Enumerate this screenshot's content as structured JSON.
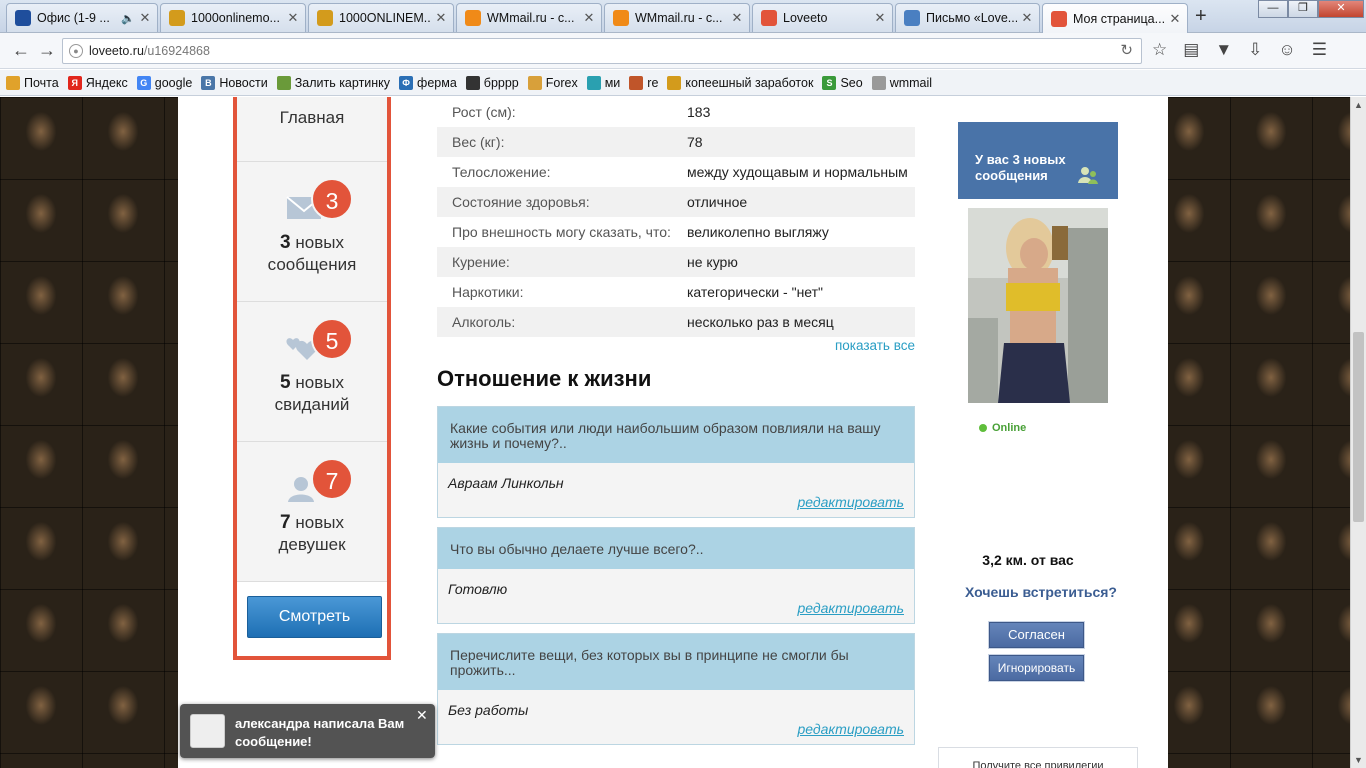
{
  "browser": {
    "tabs": [
      {
        "title": "Офис (1-9 ...",
        "icon": "office-icon",
        "color": "#1f4e9c",
        "audio": true
      },
      {
        "title": "1000onlinemo...",
        "icon": "coin-icon",
        "color": "#d39b1c"
      },
      {
        "title": "1000ONLINEM...",
        "icon": "coin-icon",
        "color": "#d39b1c"
      },
      {
        "title": "WMmail.ru - с...",
        "icon": "wmmail-icon",
        "color": "#f08a18"
      },
      {
        "title": "WMmail.ru - с...",
        "icon": "wmmail-icon",
        "color": "#f08a18"
      },
      {
        "title": "Loveeto",
        "icon": "loveeto-icon",
        "color": "#e2543a"
      },
      {
        "title": "Письмо «Love...",
        "icon": "mail-icon",
        "color": "#4a7fc1"
      },
      {
        "title": "Моя страница...",
        "icon": "loveeto-icon",
        "color": "#e2543a",
        "active": true
      }
    ],
    "url_host": "loveeto.ru",
    "url_path": "/u16924868",
    "bookmarks": [
      {
        "label": "Почта",
        "icon": "mail-folder-icon",
        "color": "#e0a22b"
      },
      {
        "label": "Яндекс",
        "icon": "yandex-icon",
        "color": "#e1261c",
        "glyph": "Я"
      },
      {
        "label": "google",
        "icon": "google-icon",
        "color": "#4285f4",
        "glyph": "G"
      },
      {
        "label": "Новости",
        "icon": "vk-icon",
        "color": "#4a76a8",
        "glyph": "В"
      },
      {
        "label": "Залить картинку",
        "icon": "upload-icon",
        "color": "#6a9a3a"
      },
      {
        "label": "ферма",
        "icon": "farm-icon",
        "color": "#2b6fb5",
        "glyph": "Ф"
      },
      {
        "label": "брррр",
        "icon": "clapper-icon",
        "color": "#333333"
      },
      {
        "label": "Forex",
        "icon": "forex-icon",
        "color": "#d8a03a"
      },
      {
        "label": "ми",
        "icon": "mi-icon",
        "color": "#2aa0b0"
      },
      {
        "label": "re",
        "icon": "re-icon",
        "color": "#c0552a"
      },
      {
        "label": "копеешный заработок",
        "icon": "coin-icon",
        "color": "#d39b1c"
      },
      {
        "label": "Seo",
        "icon": "seo-icon",
        "color": "#3a9a3a",
        "glyph": "S"
      },
      {
        "label": "wmmail",
        "icon": "wmmail-icon",
        "color": "#999999"
      }
    ]
  },
  "sidebar": {
    "main_label": "Главная",
    "sections": [
      {
        "count": "3",
        "word1": "новых",
        "word2": "сообщения",
        "icon": "envelope-icon"
      },
      {
        "count": "5",
        "word1": "новых",
        "word2": "свиданий",
        "icon": "hearts-icon"
      },
      {
        "count": "7",
        "word1": "новых",
        "word2": "девушек",
        "icon": "user-icon"
      }
    ],
    "button_label": "Смотреть"
  },
  "profile": {
    "rows": [
      {
        "k": "Рост (см):",
        "v": "183"
      },
      {
        "k": "Вес (кг):",
        "v": "78"
      },
      {
        "k": "Телосложение:",
        "v": "между худощавым и нормальным"
      },
      {
        "k": "Состояние здоровья:",
        "v": "отличное"
      },
      {
        "k": "Про внешность могу сказать, что:",
        "v": "великолепно выгляжу"
      },
      {
        "k": "Курение:",
        "v": "не курю"
      },
      {
        "k": "Наркотики:",
        "v": "категорически - \"нет\""
      },
      {
        "k": "Алкоголь:",
        "v": "несколько раз в месяц"
      }
    ],
    "show_all": "показать все",
    "section_title": "Отношение к жизни",
    "qa": [
      {
        "q": "Какие события или люди наибольшим образом повлияли на вашу жизнь и почему?..",
        "a": "Авраам Линкольн",
        "edit": "редактировать"
      },
      {
        "q": "Что вы обычно делаете лучше всего?..",
        "a": "Готовлю",
        "edit": "редактировать"
      },
      {
        "q": "Перечислите вещи, без которых вы в принципе не смогли бы прожить...",
        "a": "Без работы",
        "edit": "редактировать"
      }
    ]
  },
  "right": {
    "messages_notice": "У вас 3 новых сообщения",
    "online": "Online",
    "distance": "3,2 км. от вас",
    "meet_question": "Хочешь встретиться?",
    "agree": "Согласен",
    "ignore": "Игнорировать",
    "privileges": "Получите все привилегии"
  },
  "toast": {
    "text": "александра написала Вам сообщение!"
  }
}
